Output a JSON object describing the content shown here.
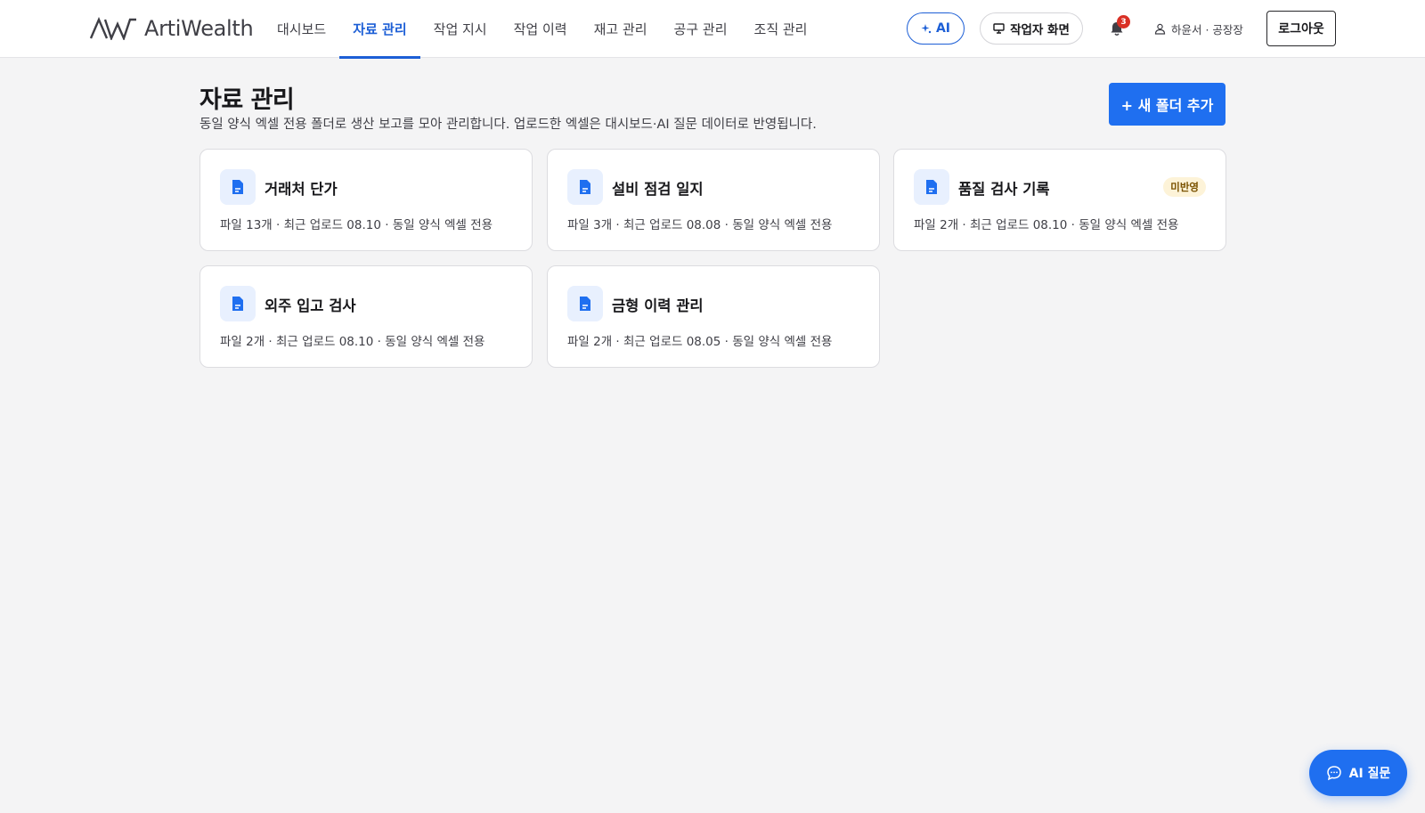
{
  "header": {
    "logo_text": "ArtiWealth",
    "nav": [
      {
        "label": "대시보드",
        "active": false
      },
      {
        "label": "자료 관리",
        "active": true
      },
      {
        "label": "작업 지시",
        "active": false
      },
      {
        "label": "작업 이력",
        "active": false
      },
      {
        "label": "재고 관리",
        "active": false
      },
      {
        "label": "공구 관리",
        "active": false
      },
      {
        "label": "조직 관리",
        "active": false
      }
    ],
    "ai_button": {
      "label": "AI",
      "icon": "sparkle-icon"
    },
    "worker_button": {
      "label": "작업자 화면",
      "icon": "monitor-icon"
    },
    "notifications": {
      "icon": "bell-icon",
      "count": "3"
    },
    "user": {
      "label": "하윤서 · 공장장",
      "icon": "user-icon"
    },
    "logout_label": "로그아웃"
  },
  "page": {
    "title": "자료 관리",
    "description": "동일 양식 엑셀 전용 폴더로 생산 보고를 모아 관리합니다. 업로드한 엑셀은 대시보드·AI 질문 데이터로 반영됩니다.",
    "add_folder_label": "+ 새 폴더 추가"
  },
  "folders": [
    {
      "title": "거래처 단가",
      "meta": "파일 13개 · 최근 업로드 08.10 · 동일 양식 엑셀 전용",
      "badge": ""
    },
    {
      "title": "설비 점검 일지",
      "meta": "파일 3개 · 최근 업로드 08.08 · 동일 양식 엑셀 전용",
      "badge": ""
    },
    {
      "title": "품질 검사 기록",
      "meta": "파일 2개 · 최근 업로드 08.10 · 동일 양식 엑셀 전용",
      "badge": "미반영"
    },
    {
      "title": "외주 입고 검사",
      "meta": "파일 2개 · 최근 업로드 08.10 · 동일 양식 엑셀 전용",
      "badge": ""
    },
    {
      "title": "금형 이력 관리",
      "meta": "파일 2개 · 최근 업로드 08.05 · 동일 양식 엑셀 전용",
      "badge": ""
    }
  ],
  "fab": {
    "label": "AI 질문",
    "icon": "chat-icon"
  },
  "colors": {
    "accent": "#1f6ff0",
    "nav_active": "#1d5fd6",
    "badge_bg": "#fdf3d8",
    "notification": "#d93025"
  }
}
